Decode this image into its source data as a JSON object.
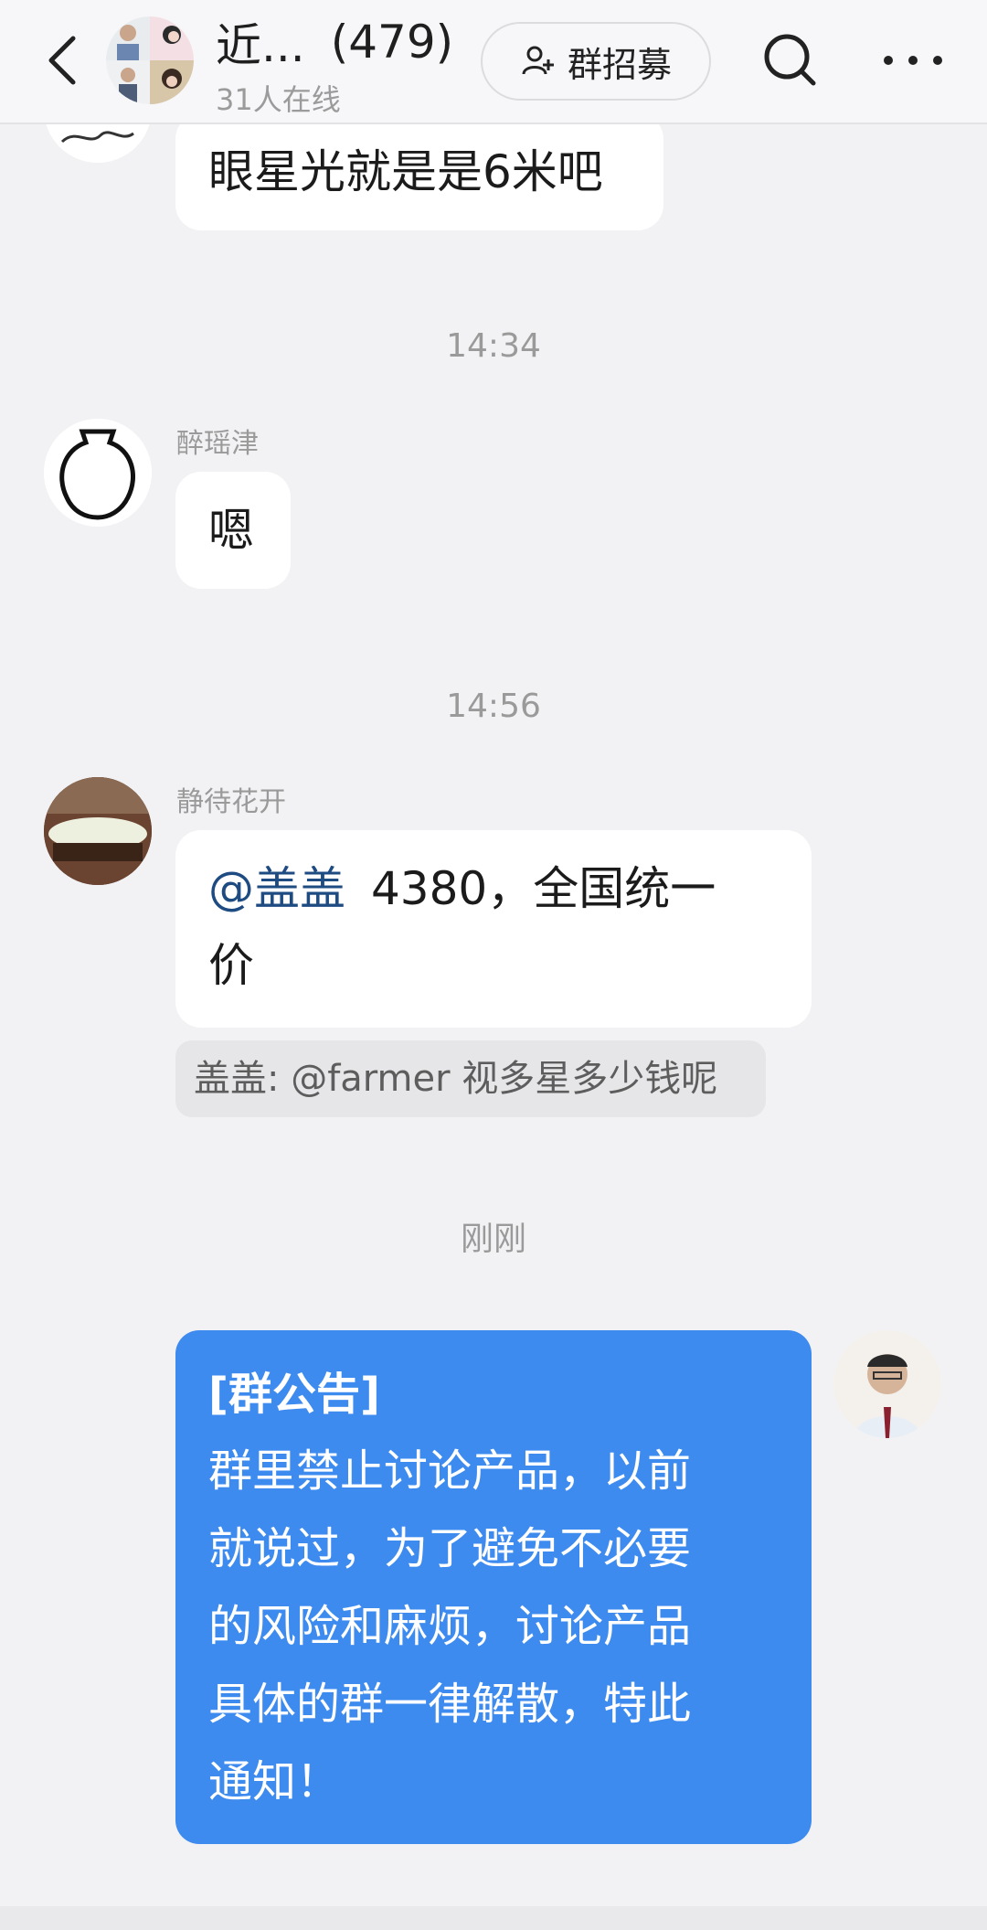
{
  "header": {
    "title": "近...",
    "member_count": "(479)",
    "online_status": "31人在线",
    "recruit_label": "群招募"
  },
  "messages": {
    "m1": {
      "text": "眼星光就是是6米吧"
    },
    "time1": "14:34",
    "m2": {
      "sender": "醉瑶津",
      "text": "嗯"
    },
    "time2": "14:56",
    "m3": {
      "sender": "静待花开",
      "mention": "@盖盖",
      "text_line1": "4380，全国统一",
      "text_line2": "价",
      "quote": "盖盖: @farmer 视多星多少钱呢"
    },
    "time3": "刚刚",
    "m4": {
      "notice_title": "[群公告]",
      "lines": [
        "群里禁止讨论产品，以前",
        "就说过，为了避免不必要",
        "的风险和麻烦，讨论产品",
        "具体的群一律解散，特此",
        "通知！"
      ]
    }
  },
  "colors": {
    "notice_bg": "#3e8bef",
    "mention": "#1e4b82",
    "page_bg": "#f2f2f4"
  }
}
